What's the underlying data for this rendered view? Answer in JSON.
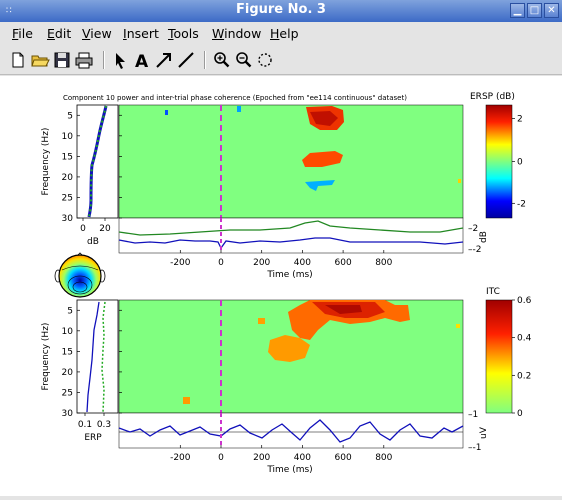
{
  "window": {
    "title": "Figure No. 3"
  },
  "menu": [
    {
      "label": "File",
      "u": "F",
      "rest": "ile"
    },
    {
      "label": "Edit",
      "u": "E",
      "rest": "dit"
    },
    {
      "label": "View",
      "u": "V",
      "rest": "iew"
    },
    {
      "label": "Insert",
      "u": "I",
      "rest": "nsert"
    },
    {
      "label": "Tools",
      "u": "T",
      "rest": "ools"
    },
    {
      "label": "Window",
      "u": "W",
      "rest": "indow"
    },
    {
      "label": "Help",
      "u": "H",
      "rest": "elp"
    }
  ],
  "toolbar_icons": [
    "new-file-icon",
    "open-folder-icon",
    "save-icon",
    "print-icon",
    "pointer-arrow-icon",
    "text-tool-icon",
    "arrow-tool-icon",
    "line-tool-icon",
    "zoom-in-icon",
    "zoom-out-icon",
    "rotate-icon"
  ],
  "figure": {
    "title": "Component 10 power and inter-trial phase coherence (Epoched from \"ee114 continuous\" dataset)",
    "ersp_colorbar_label": "ERSP (dB)",
    "itc_colorbar_label": "ITC",
    "freq_label": "Frequency (Hz)",
    "time_label": "Time (ms)",
    "db_label": "dB",
    "erp_label": "ERP",
    "uv_label": "uV",
    "freq_ticks": [
      "5",
      "10",
      "15",
      "20",
      "25",
      "30"
    ],
    "time_ticks": [
      "-200",
      "0",
      "200",
      "400",
      "600",
      "800"
    ],
    "ersp_side_ticks": [
      "0",
      "20"
    ],
    "itc_side_ticks": [
      "0.1",
      "0.3"
    ],
    "ersp_cbar_ticks": [
      "2",
      "0",
      "-2"
    ],
    "itc_cbar_ticks": [
      "0.6",
      "0.4",
      "0.2",
      "0"
    ],
    "ersp_trace_ticks": [
      "2",
      "-2"
    ],
    "erp_trace_ticks": [
      "1",
      "-1"
    ]
  },
  "colors": {
    "background_field": "#80ff80",
    "marker": "#cc33cc",
    "trace_green": "#228822",
    "trace_blue": "#1111bb"
  }
}
